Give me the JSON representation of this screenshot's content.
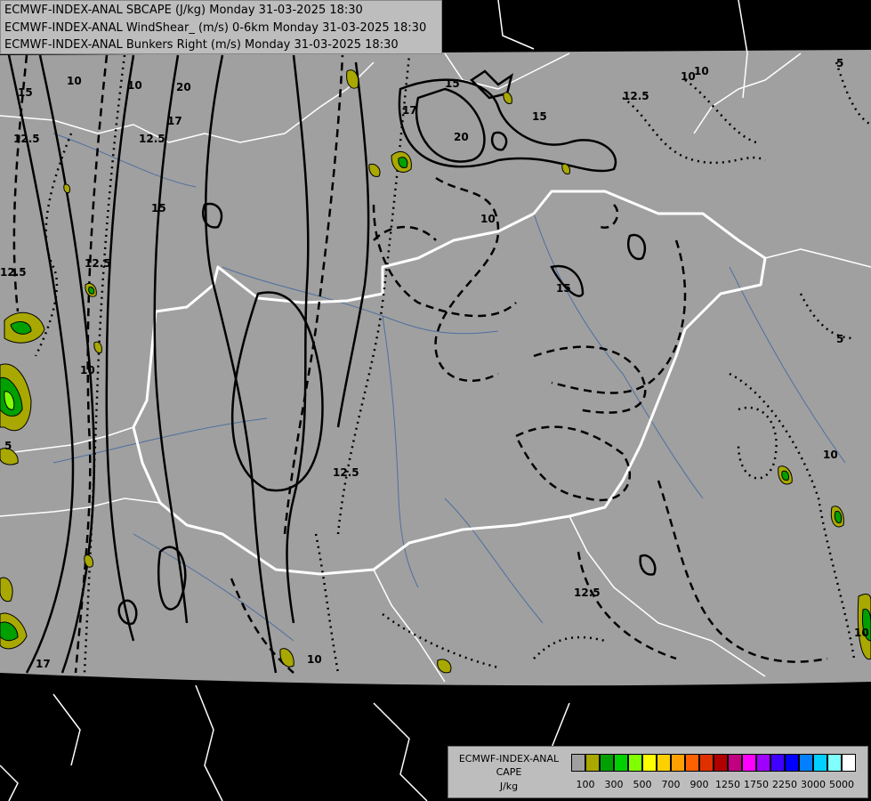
{
  "header": {
    "lines": [
      "ECMWF-INDEX-ANAL SBCAPE (J/kg) Monday 31-03-2025 18:30",
      "ECMWF-INDEX-ANAL WindShear_ (m/s) 0-6km Monday 31-03-2025 18:30",
      "ECMWF-INDEX-ANAL Bunkers Right (m/s) Monday 31-03-2025 18:30"
    ]
  },
  "legend": {
    "title_lines": [
      "ECMWF-INDEX-ANAL",
      "CAPE",
      "J/kg"
    ],
    "colors": [
      "#a0a0a0",
      "#a8a800",
      "#00a000",
      "#00d000",
      "#80ff00",
      "#ffff00",
      "#ffd000",
      "#ffa000",
      "#ff6000",
      "#e03000",
      "#b00000",
      "#c00080",
      "#ff00ff",
      "#a000ff",
      "#4000ff",
      "#0000ff",
      "#0080ff",
      "#00d0ff",
      "#80ffff",
      "#ffffff"
    ],
    "tick_labels": [
      "100",
      "300",
      "500",
      "700",
      "900",
      "1250",
      "1750",
      "2250",
      "3000",
      "5000"
    ]
  },
  "contour_labels": {
    "shear": [
      "15",
      "10",
      "10",
      "12.5",
      "20",
      "17",
      "12.5",
      "10",
      "15",
      "17",
      "15",
      "12.5",
      "10",
      "5",
      "15",
      "15",
      "20",
      "12.5",
      "12.5",
      "12.5",
      "10",
      "10",
      "12.5",
      "17",
      "5",
      "10",
      "10",
      "10",
      "5"
    ]
  },
  "colors": {
    "background": "#000000",
    "domain": "#a0a0a0",
    "border": "#ffffff",
    "river": "#4f6f9f",
    "contour": "#000000"
  }
}
